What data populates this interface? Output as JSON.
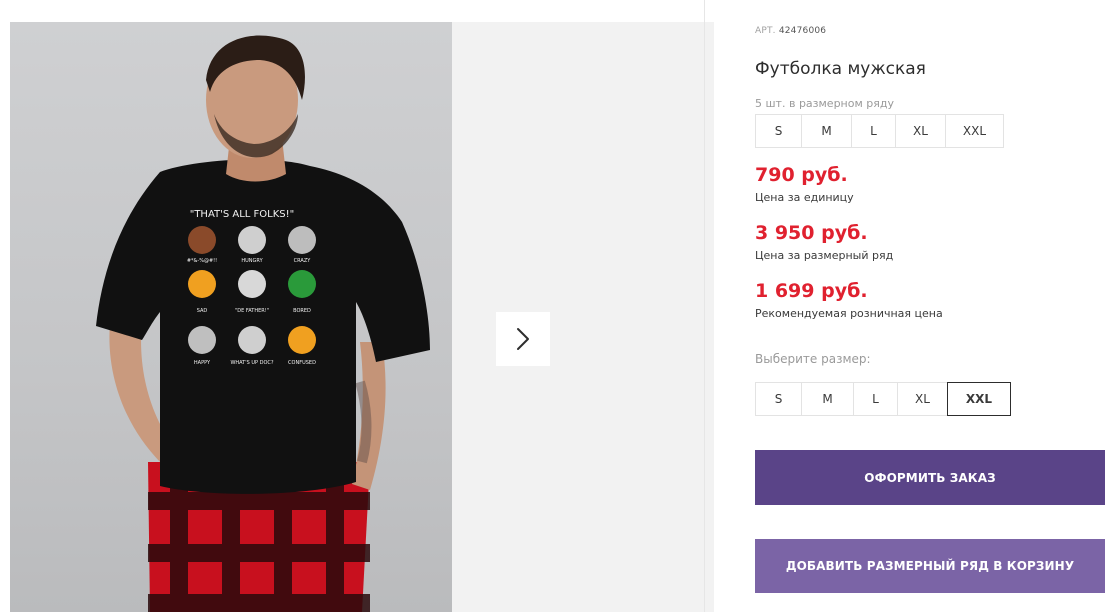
{
  "gallery": {
    "photo_alt": "",
    "shirt_print": {
      "headline": "\"THAT'S ALL FOLKS!\"",
      "captions": [
        "#*&-%@#!!",
        "HUNGRY",
        "CRAZY",
        "SAD",
        "\"DE FATHER!\"",
        "BORED",
        "HAPPY",
        "WHAT'S UP DOC?",
        "CONFUSED"
      ]
    },
    "next_icon": "chevron-right-icon"
  },
  "product": {
    "sku_label": "АРТ.",
    "sku_value": "42476006",
    "title": "Футболка мужская",
    "pack_note": "5 шт. в размерном ряду",
    "pack_sizes": [
      "S",
      "M",
      "L",
      "XL",
      "XXL"
    ],
    "prices": [
      {
        "value": "790 руб.",
        "label": "Цена за единицу"
      },
      {
        "value": "3 950 руб.",
        "label": "Цена за размерный ряд"
      },
      {
        "value": "1 699 руб.",
        "label": "Рекомендуемая розничная цена"
      }
    ],
    "choose_size_label": "Выберите размер:",
    "select_sizes": [
      "S",
      "M",
      "L",
      "XL",
      "XXL"
    ],
    "selected_size": "XXL",
    "order_button": "ОФОРМИТЬ ЗАКАЗ",
    "add_button": "ДОБАВИТЬ РАЗМЕРНЫЙ РЯД В КОРЗИНУ"
  },
  "colors": {
    "price": "#e0212f",
    "primary_button": "#5a4488",
    "secondary_button": "#7b64a6"
  }
}
